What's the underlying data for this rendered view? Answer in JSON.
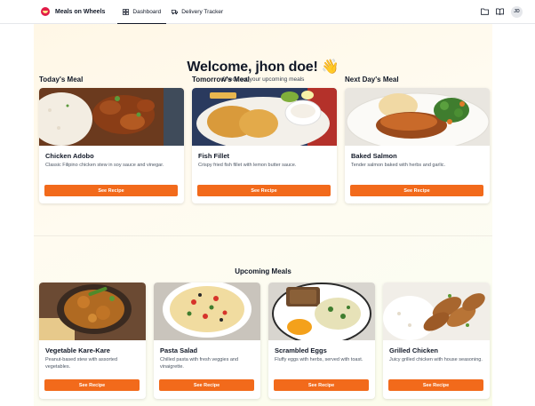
{
  "header": {
    "brand": "Meals on Wheels",
    "nav": [
      {
        "label": "Dashboard",
        "icon": "grid-icon",
        "active": true
      },
      {
        "label": "Delivery Tracker",
        "icon": "truck-icon",
        "active": false
      }
    ],
    "icons": [
      "folder-icon",
      "book-icon"
    ],
    "avatar_initials": "JD"
  },
  "welcome": {
    "title": "Welcome, jhon doe! 👋",
    "subtitle": "Check out your upcoming meals"
  },
  "featured": [
    {
      "section": "Today's Meal",
      "name": "Chicken Adobo",
      "description": "Classic Filipino chicken stew in soy sauce and vinegar.",
      "button": "See Recipe"
    },
    {
      "section": "Tomorrow's Meal",
      "name": "Fish Fillet",
      "description": "Crispy fried fish fillet with lemon butter sauce.",
      "button": "See Recipe"
    },
    {
      "section": "Next Day's Meal",
      "name": "Baked Salmon",
      "description": "Tender salmon baked with herbs and garlic.",
      "button": "See Recipe"
    }
  ],
  "upcoming_title": "Upcoming Meals",
  "upcoming": [
    {
      "name": "Vegetable Kare-Kare",
      "description": "Peanut-based stew with assorted vegetables.",
      "button": "See Recipe"
    },
    {
      "name": "Pasta Salad",
      "description": "Chilled pasta with fresh veggies and vinaigrette.",
      "button": "See Recipe"
    },
    {
      "name": "Scrambled Eggs",
      "description": "Fluffy eggs with herbs, served with toast.",
      "button": "See Recipe"
    },
    {
      "name": "Grilled Chicken",
      "description": "Juicy grilled chicken with house seasoning.",
      "button": "See Recipe"
    }
  ],
  "colors": {
    "accent": "#f26a1b",
    "brand": "#e11d48"
  }
}
